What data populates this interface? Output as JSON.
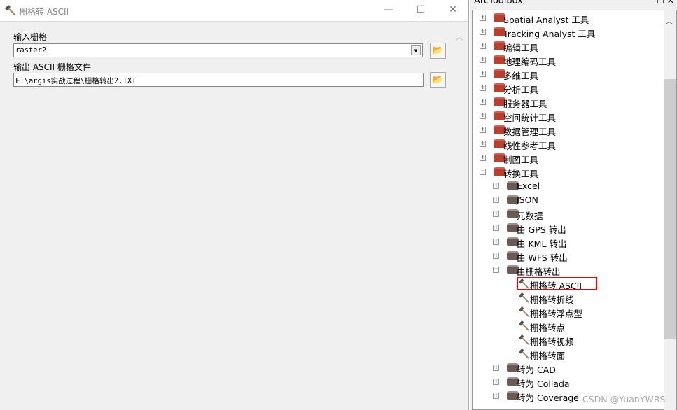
{
  "dialog": {
    "title": "栅格转 ASCII",
    "input_label": "输入栅格",
    "input_value": "raster2",
    "output_label": "输出 ASCII 栅格文件",
    "output_value": "F:\\argis实战过程\\栅格转出2.TXT"
  },
  "toolbox": {
    "title": "ArcToolbox",
    "items": [
      {
        "label": "Spatial Analyst 工具",
        "level": 0,
        "exp": "+"
      },
      {
        "label": "Tracking Analyst 工具",
        "level": 0,
        "exp": "+"
      },
      {
        "label": "编辑工具",
        "level": 0,
        "exp": "+"
      },
      {
        "label": "地理编码工具",
        "level": 0,
        "exp": "+"
      },
      {
        "label": "多维工具",
        "level": 0,
        "exp": "+"
      },
      {
        "label": "分析工具",
        "level": 0,
        "exp": "+"
      },
      {
        "label": "服务器工具",
        "level": 0,
        "exp": "+"
      },
      {
        "label": "空间统计工具",
        "level": 0,
        "exp": "+"
      },
      {
        "label": "数据管理工具",
        "level": 0,
        "exp": "+"
      },
      {
        "label": "线性参考工具",
        "level": 0,
        "exp": "+"
      },
      {
        "label": "制图工具",
        "level": 0,
        "exp": "+"
      },
      {
        "label": "转换工具",
        "level": 0,
        "exp": "−"
      },
      {
        "label": "Excel",
        "level": 1,
        "exp": "+"
      },
      {
        "label": "JSON",
        "level": 1,
        "exp": "+"
      },
      {
        "label": "元数据",
        "level": 1,
        "exp": "+"
      },
      {
        "label": "由 GPS 转出",
        "level": 1,
        "exp": "+"
      },
      {
        "label": "由 KML 转出",
        "level": 1,
        "exp": "+"
      },
      {
        "label": "由 WFS 转出",
        "level": 1,
        "exp": "+"
      },
      {
        "label": "由栅格转出",
        "level": 1,
        "exp": "−"
      },
      {
        "label": "栅格转 ASCII",
        "level": 2
      },
      {
        "label": "栅格转折线",
        "level": 2
      },
      {
        "label": "栅格转浮点型",
        "level": 2
      },
      {
        "label": "栅格转点",
        "level": 2
      },
      {
        "label": "栅格转视频",
        "level": 2
      },
      {
        "label": "栅格转面",
        "level": 2
      },
      {
        "label": "转为 CAD",
        "level": 1,
        "exp": "+"
      },
      {
        "label": "转为 Collada",
        "level": 1,
        "exp": "+"
      },
      {
        "label": "转为 Coverage",
        "level": 1,
        "exp": "+"
      }
    ]
  },
  "watermark": "CSDN @YuanYWRS"
}
